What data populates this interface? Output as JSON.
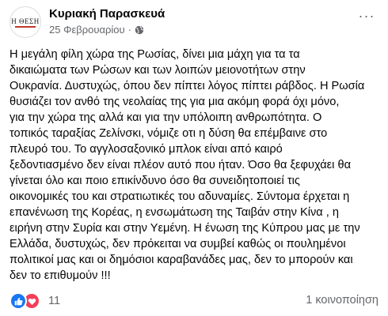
{
  "post": {
    "page_name": "Κυριακή Παρασκευά",
    "date": "25 Φεβρουαρίου",
    "separator": "·",
    "privacy_icon": "globe-icon",
    "more_label": "···",
    "avatar": {
      "text": "Η ΘΕΣΗ"
    },
    "text_lines": [
      "Η μεγάλη φίλη χώρα της Ρωσίας, δίνει μια μάχη για τα τα",
      "δικαιώματα των Ρώσων και των λοιπών μειονοτήτων στην",
      "Ουκρανία. Δυστυχώς, όπου δεν πίπτει λόγος πίπτει ράβδος. Η Ρωσία",
      "θυσιάζει τον ανθό της νεολαίας της για μια ακόμη φορά όχι μόνο,",
      "για την χώρα της αλλά και για την υπόλοιπη ανθρωπότητα. Ο",
      "τοπικός ταραξίας Ζελίνσκι, νόμιζε οτι η δύση θα επέμβαινε στο",
      "πλευρό του. Το αγγλοσαξονικό μπλοκ είναι από καιρό",
      "ξεδοντιασμένο δεν είναι πλέον αυτό που ήταν. Όσο θα ξεφυχάει θα",
      "γίνεται όλο και ποιο επικίνδυνο όσο θα συνειδητοποιεί τις",
      "οικονομικές του και στρατιωτικές του αδυναμίες.  Σύντομα έρχεται η",
      "επανένωση της Κορέας, η ενσωμάτωση της Ταιβάν στην Κίνα , η",
      "ειρήνη στην Συρία και στην Υεμένη. Η ένωση της Κύπρου μας  με την",
      "Ελλάδα, δυστυχώς, δεν πρόκειται να συμβεί καθώς οι πουλημένοι",
      "πολιτικοί μας και οι δημόσιοι καραβανάδες μας, δεν το μπορούν και",
      "δεν το επιθυμούν !!!"
    ]
  },
  "footer": {
    "reaction_icons": [
      "like-icon",
      "love-icon"
    ],
    "reaction_count": "11",
    "shares": "1 κοινοποίηση"
  },
  "colors": {
    "like": "#1877f2",
    "love": "#f33e58",
    "secondary_text": "#65676b",
    "avatar_accent": "#c0392b"
  }
}
